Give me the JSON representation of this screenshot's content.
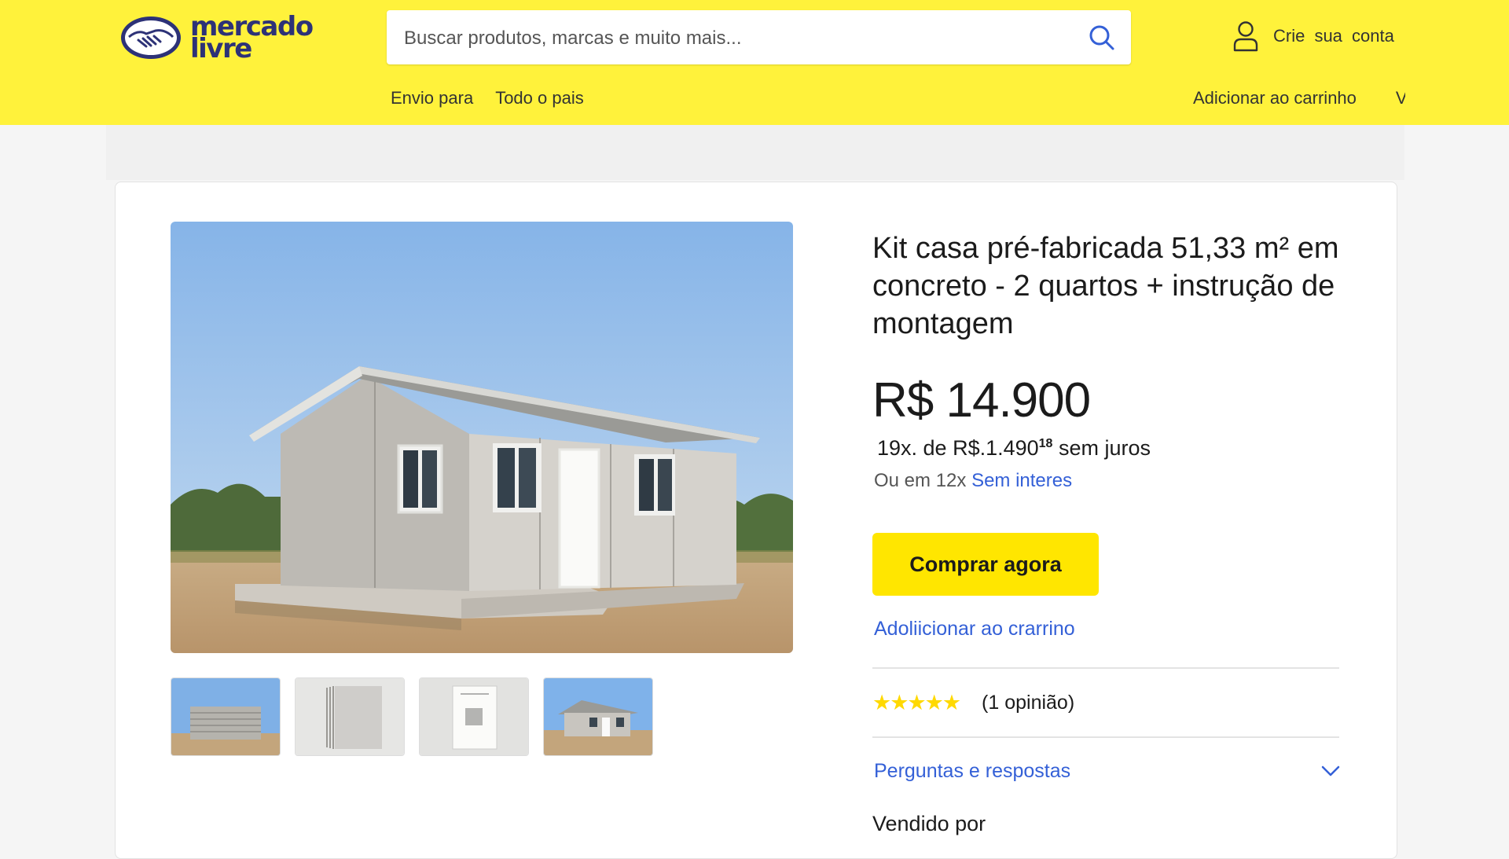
{
  "header": {
    "logo_line1": "mercado",
    "logo_line2": "livre",
    "search_placeholder": "Buscar produtos, marcas e muito mais...",
    "account_label": "Crie sua  conta",
    "shipping_label": "Envio para",
    "shipping_value": "Todo o pais",
    "cart_nav": "Adicionar ao carrinho",
    "nav_truncated": "V"
  },
  "product": {
    "title": "Kit casa pré-fabricada 51,33 m² em concreto - 2 quartos + instrução de montagem",
    "price": "R$ 14.900",
    "installments_prefix": "19x. de R$.1.490",
    "installments_cents": "18",
    "installments_suffix": "sem juros",
    "alt_installments_prefix": "Ou em 12x",
    "alt_installments_link": "Sem interes",
    "buy_button": "Comprar agora",
    "add_cart_link": "Adoliicionar ao crarrino",
    "rating_stars": "★★★★★",
    "rating_value": 4.5,
    "rating_count": "(1 opinião)",
    "qa_label": "Perguntas e respostas",
    "seller_label": "Vendido por"
  },
  "colors": {
    "header_bg": "#fff23b",
    "brand_navy": "#2d3277",
    "link_blue": "#3460d7",
    "buy_button_bg": "#ffe600",
    "star": "#ffd900"
  },
  "icons": [
    "search-icon",
    "user-icon",
    "chevron-down-icon",
    "star-icon"
  ]
}
